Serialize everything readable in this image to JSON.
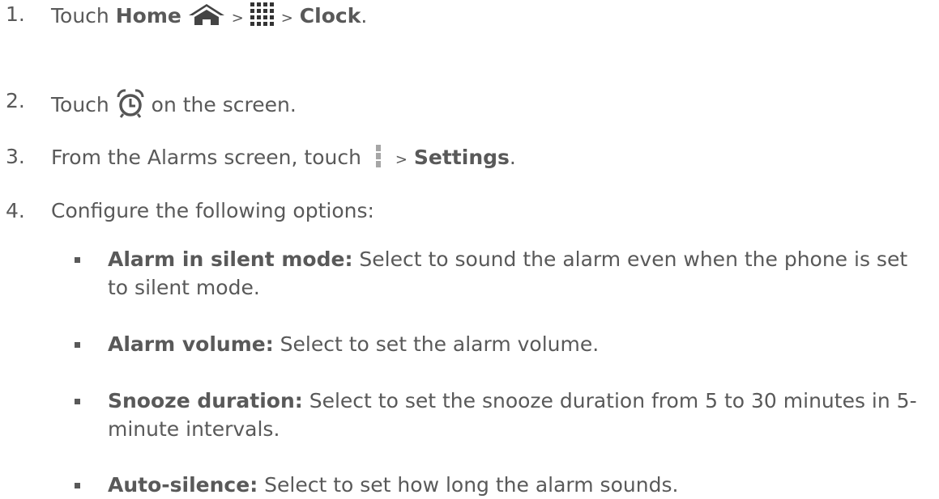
{
  "steps": [
    {
      "number": "1.",
      "parts": {
        "touch": "Touch",
        "home": "Home",
        "sep1": ">",
        "sep2": ">",
        "clock": "Clock",
        "end": "."
      }
    },
    {
      "number": "2.",
      "parts": {
        "touch": "Touch",
        "rest": "on the screen."
      }
    },
    {
      "number": "3.",
      "parts": {
        "pre": "From the Alarms screen, touch",
        "sep": ">",
        "settings": "Settings",
        "end": "."
      }
    },
    {
      "number": "4.",
      "text": "Configure the following options:"
    }
  ],
  "options": [
    {
      "term": "Alarm in silent mode:",
      "desc": "Select to sound the alarm even when the phone is set to silent mode."
    },
    {
      "term": "Alarm volume:",
      "desc": "Select to set the alarm volume."
    },
    {
      "term": "Snooze duration:",
      "desc": "Select to set the snooze duration from 5 to 30 minutes in 5-minute intervals."
    },
    {
      "term": "Auto-silence:",
      "desc": "Select to set how long the alarm sounds."
    }
  ],
  "icons": {
    "home": "home-icon",
    "apps": "apps-grid-icon",
    "alarm": "alarm-clock-icon",
    "menu": "menu-icon"
  },
  "colors": {
    "text": "#595959",
    "icon": "#444444",
    "menu_icon": "#a6a6a6"
  }
}
